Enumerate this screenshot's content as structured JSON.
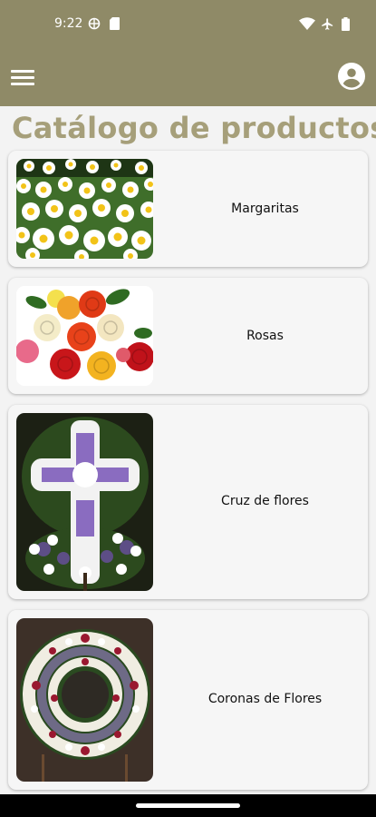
{
  "status_bar": {
    "time": "9:22"
  },
  "header": {
    "menu_icon": "menu-icon",
    "account_icon": "account-circle-icon"
  },
  "page": {
    "title": "Catálogo de productos"
  },
  "products": [
    {
      "name": "Margaritas",
      "image": "daisies-image"
    },
    {
      "name": "Rosas",
      "image": "roses-image"
    },
    {
      "name": "Cruz de flores",
      "image": "flower-cross-image"
    },
    {
      "name": "Coronas de Flores",
      "image": "flower-wreath-image"
    }
  ],
  "colors": {
    "brand": "#8f8a67",
    "title": "#a69f7a",
    "card": "#f6f6f6"
  }
}
